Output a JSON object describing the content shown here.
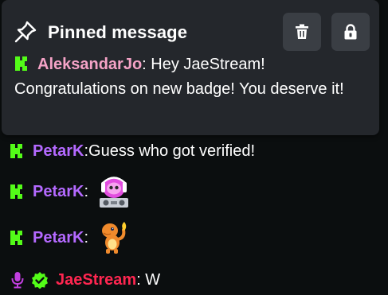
{
  "pinned": {
    "title": "Pinned message",
    "username": "AleksandarJo",
    "separator": ":",
    "message": " Hey JaeStream! Congratulations on new badge! You deserve it!"
  },
  "chat": [
    {
      "username": "PetarK",
      "separator": ":",
      "message": " Guess who got verified!"
    },
    {
      "username": "PetarK",
      "separator": ":",
      "emote": "dj-robot-emote"
    },
    {
      "username": "PetarK",
      "separator": ":",
      "emote": "charmander-emote"
    },
    {
      "username": "JaeStream",
      "separator": ":",
      "message": " W"
    }
  ],
  "colors": {
    "background": "#0b0e0f",
    "panel": "#24272c",
    "button": "#3a3e44",
    "kick_green": "#53fc18",
    "name_pink": "#f5a3c7",
    "name_purple": "#b469ff",
    "name_red": "#ff2650",
    "mic_badge": "#c23fe0"
  }
}
